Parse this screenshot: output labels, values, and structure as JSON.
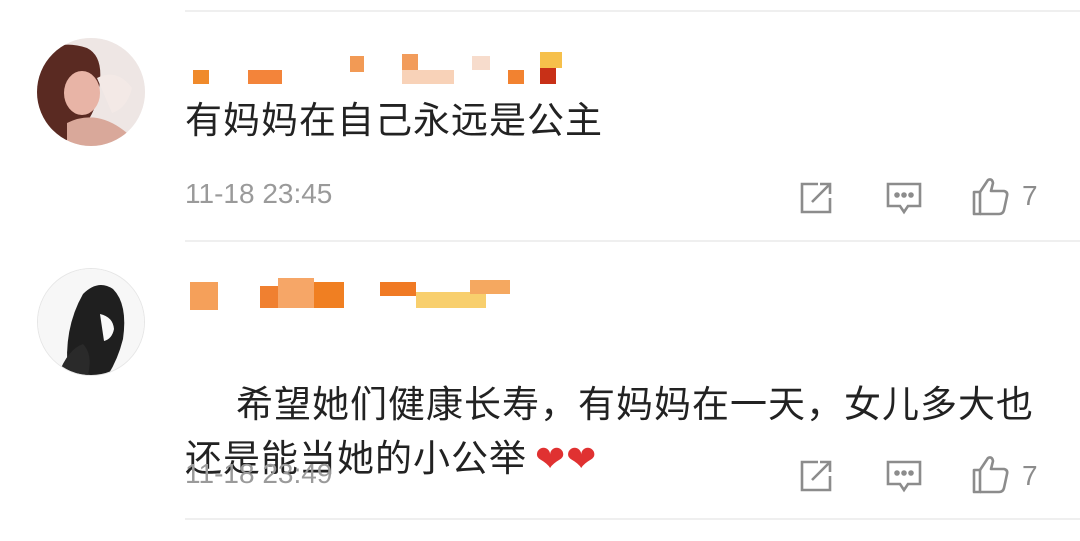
{
  "comments": [
    {
      "text": "有妈妈在自己永远是公主",
      "time": "11-18 23:45",
      "likes": "7"
    },
    {
      "text": "希望她们健康长寿，有妈妈在一天，女儿多大也\n还是能当她的小公举",
      "emoji": "❤❤",
      "time": "11-18 23:49",
      "likes": "7"
    }
  ],
  "icons": [
    "share-icon",
    "reply-icon",
    "thumbs-up-icon"
  ],
  "colors": {
    "text": "#222222",
    "muted": "#9a9a9a",
    "heart": "#e03131",
    "mosaic": "#f07f22"
  }
}
